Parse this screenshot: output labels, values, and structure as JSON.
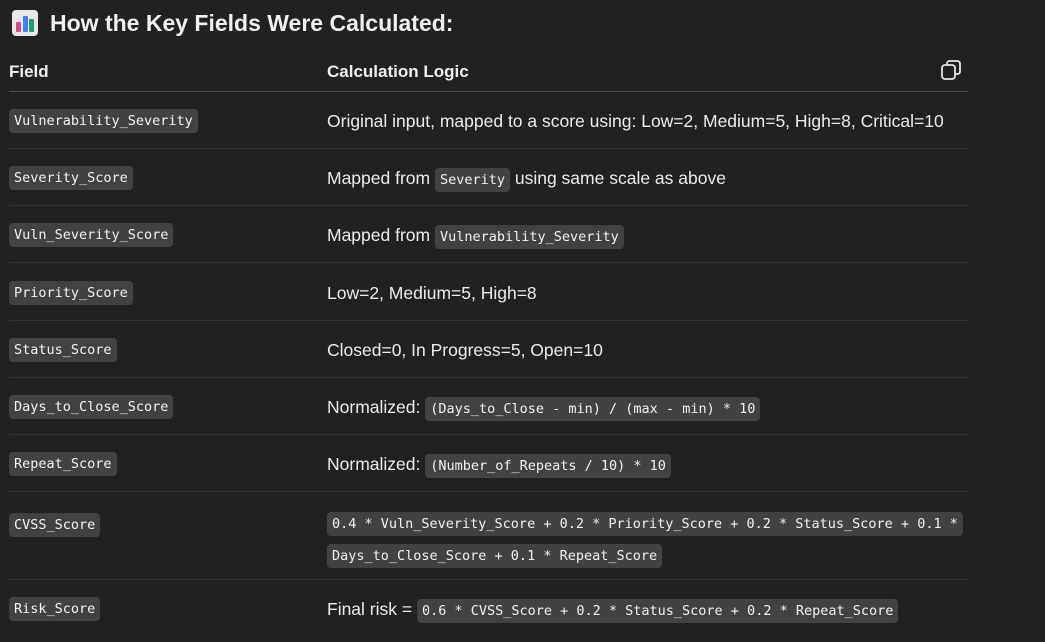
{
  "heading": {
    "title": "How the Key Fields Were Calculated:",
    "icon": "bar-chart-emoji"
  },
  "table": {
    "headers": {
      "field": "Field",
      "logic": "Calculation Logic"
    },
    "rows": [
      {
        "field": "Vulnerability_Severity",
        "text1": "Original input, mapped to a score using: Low=2, Medium=5, High=8, Critical=10"
      },
      {
        "field": "Severity_Score",
        "text1": "Mapped from ",
        "code1": "Severity",
        "text2": " using same scale as above"
      },
      {
        "field": "Vuln_Severity_Score",
        "text1": "Mapped from ",
        "code1": "Vulnerability_Severity"
      },
      {
        "field": "Priority_Score",
        "text1": "Low=2, Medium=5, High=8"
      },
      {
        "field": "Status_Score",
        "text1": "Closed=0, In Progress=5, Open=10"
      },
      {
        "field": "Days_to_Close_Score",
        "text1": "Normalized: ",
        "code1": "(Days_to_Close - min) / (max - min) * 10"
      },
      {
        "field": "Repeat_Score",
        "text1": "Normalized: ",
        "code1": "(Number_of_Repeats / 10) * 10"
      },
      {
        "field": "CVSS_Score",
        "code1": "0.4 * Vuln_Severity_Score + 0.2 * Priority_Score + 0.2 * Status_Score + 0.1 * Days_to_Close_Score + 0.1 * Repeat_Score"
      },
      {
        "field": "Risk_Score",
        "text1": "Final risk = ",
        "code1": "0.6 * CVSS_Score + 0.2 * Status_Score + 0.2 * Repeat_Score"
      }
    ]
  }
}
